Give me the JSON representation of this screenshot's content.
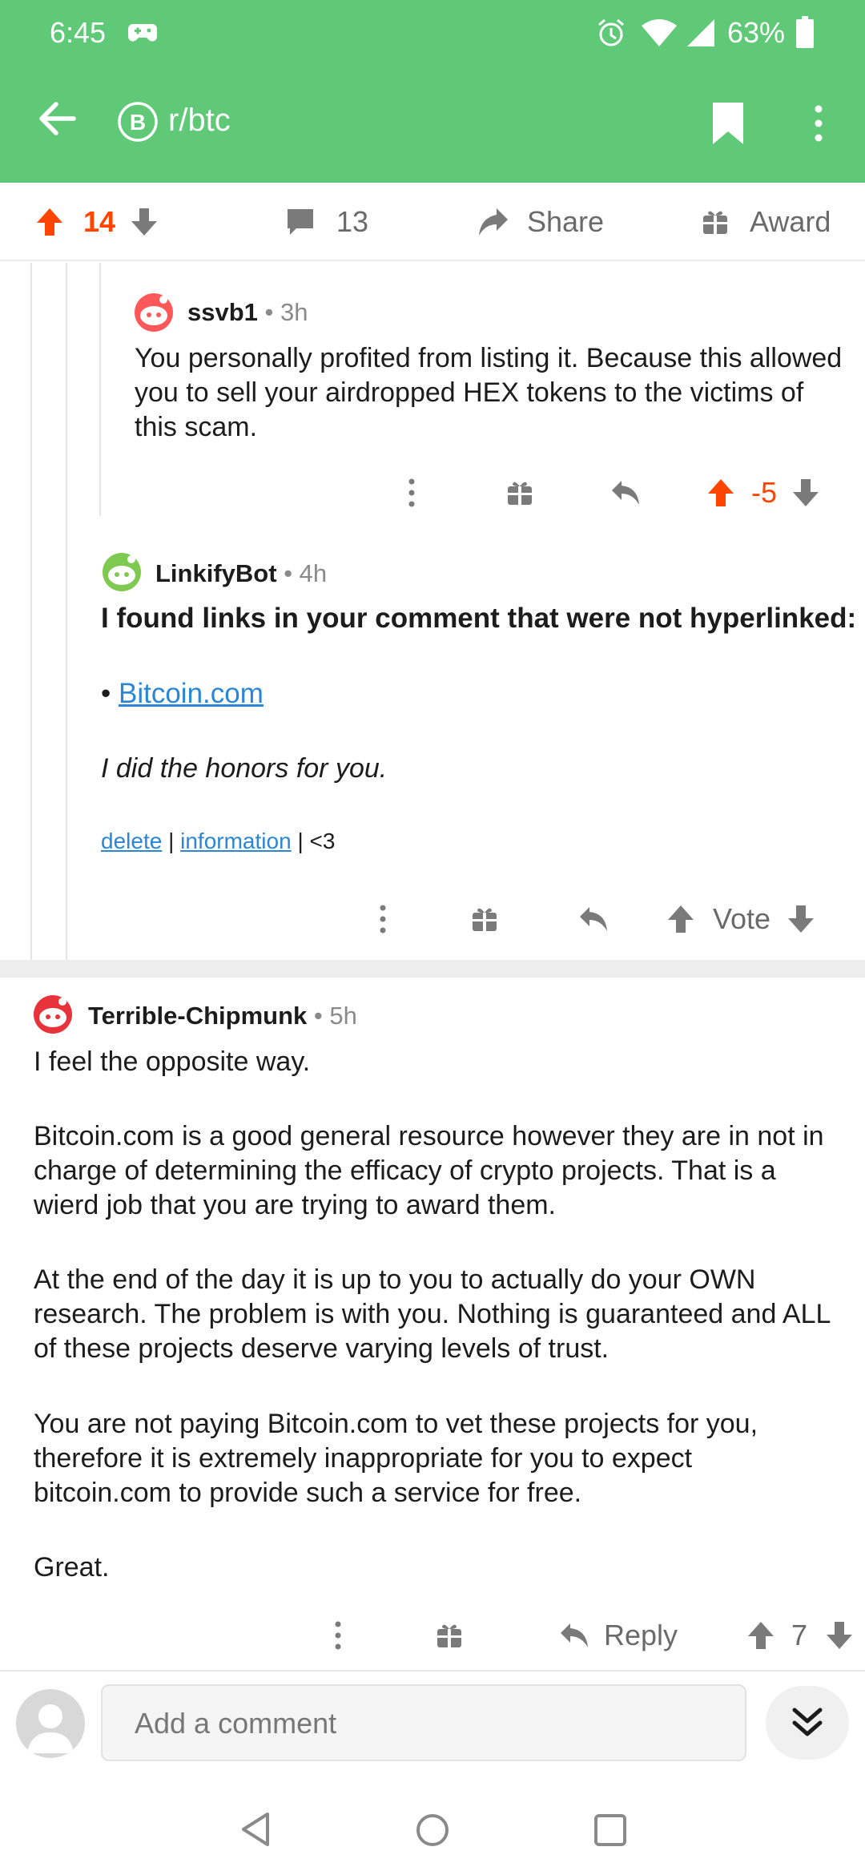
{
  "status": {
    "time": "6:45",
    "battery": "63%"
  },
  "header": {
    "subreddit": "r/btc",
    "subreddit_icon_glyph": "B"
  },
  "post_actions": {
    "score": "14",
    "comments": "13",
    "share": "Share",
    "award": "Award"
  },
  "comments": [
    {
      "user": "ssvb1",
      "meta": "• 3h",
      "body": "You personally profited from listing it. Because this allowed you to sell your airdropped HEX tokens to the victims of this scam.",
      "score": "-5"
    },
    {
      "user": "LinkifyBot",
      "meta": "• 4h",
      "heading": "I found links in your comment that were not hyperlinked:",
      "bullet": "•",
      "link": "Bitcoin.com",
      "note": "I did the honors for you.",
      "footer": {
        "delete": "delete",
        "sep1": "|",
        "information": "information",
        "sep2": "|",
        "heart": "<3"
      },
      "vote_label": "Vote"
    },
    {
      "user": "Terrible-Chipmunk",
      "meta": "• 5h",
      "paragraphs": [
        "I feel the opposite way.",
        "Bitcoin.com is a good general resource however they are in not in charge of determining the efficacy of crypto projects. That is a wierd job that you are trying to award them.",
        "At the end of the day it is up to you to actually do your OWN research.  The problem is with you.  Nothing is guaranteed and ALL of these projects deserve varying levels of trust.",
        "You are not paying Bitcoin.com to vet these projects for you, therefore it is extremely inappropriate for you to expect bitcoin.com to provide such a service for free.",
        "Great."
      ],
      "reply_label": "Reply",
      "score": "7"
    }
  ],
  "composer": {
    "placeholder": "Add a comment"
  },
  "colors": {
    "header": "#5fc978",
    "upvote": "#ff4500",
    "link": "#2b86d6"
  }
}
